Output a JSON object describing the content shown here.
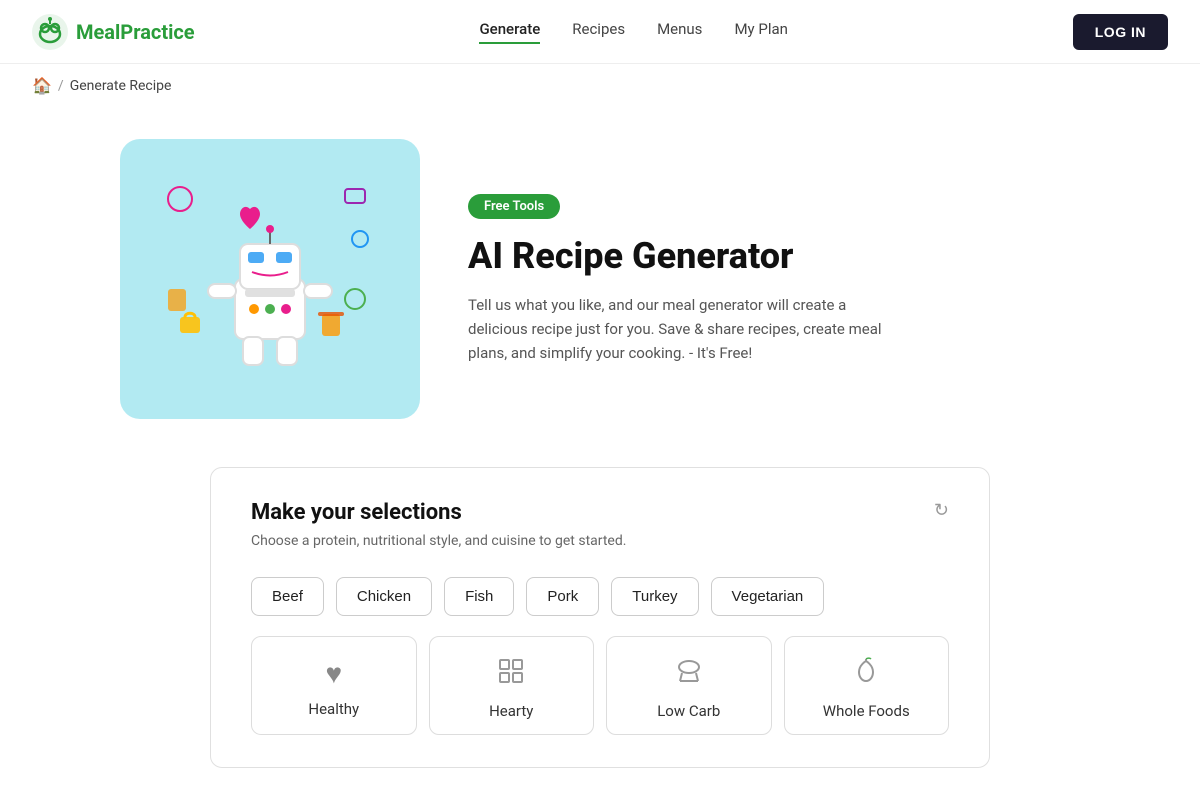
{
  "brand": {
    "name": "MealPractice",
    "logo_alt": "MealPractice logo"
  },
  "nav": {
    "links": [
      {
        "label": "Generate",
        "active": true
      },
      {
        "label": "Recipes",
        "active": false
      },
      {
        "label": "Menus",
        "active": false
      },
      {
        "label": "My Plan",
        "active": false
      }
    ],
    "login_label": "LOG IN"
  },
  "breadcrumb": {
    "home_icon": "🏠",
    "separator": "/",
    "current": "Generate Recipe"
  },
  "hero": {
    "badge": "Free Tools",
    "title": "AI Recipe Generator",
    "description": "Tell us what you like, and our meal generator will create a delicious recipe just for you. Save & share recipes, create meal plans, and simplify your cooking. - It's Free!"
  },
  "selections": {
    "title": "Make your selections",
    "subtitle": "Choose a protein, nutritional style, and cuisine to get started.",
    "proteins": [
      {
        "label": "Beef"
      },
      {
        "label": "Chicken"
      },
      {
        "label": "Fish"
      },
      {
        "label": "Pork"
      },
      {
        "label": "Turkey"
      },
      {
        "label": "Vegetarian"
      }
    ],
    "styles": [
      {
        "label": "Healthy",
        "icon": "♥"
      },
      {
        "label": "Hearty",
        "icon": "⊞"
      },
      {
        "label": "Low Carb",
        "icon": "🍖"
      },
      {
        "label": "Whole Foods",
        "icon": "🍏"
      }
    ]
  }
}
